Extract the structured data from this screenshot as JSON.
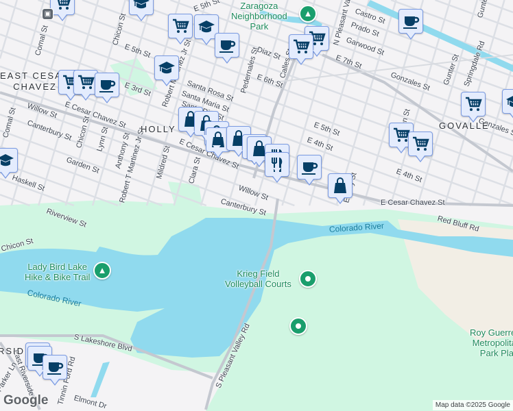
{
  "map": {
    "colors": {
      "land": "#f4f3f5",
      "water": "#90daee",
      "park": "#d0f6e2",
      "sand": "#f2eee5",
      "road": "#d6d9e0",
      "major_road": "#c4c8d0",
      "marker_bg": "#e4ecfd",
      "marker_border": "#7b9be2",
      "marker_icon": "#063f66",
      "park_pin": "#1a9e6c"
    },
    "neighborhoods": [
      "EAST CESAR\nCHAVEZ",
      "HOLLY",
      "GOVALLE",
      "RSIDE"
    ],
    "parks": [
      "Parque\nZaragoza\nNeighborhood\nPark",
      "Lady Bird Lake\nHike & Bike Trail",
      "Krieg Field\nVolleyball Courts",
      "Roy Guerrero\nMetropolitan\nPark Pla"
    ],
    "water": [
      "Colorado River",
      "Colorado River"
    ],
    "streets": [
      "E 5th St",
      "Comal St",
      "Chicon St",
      "E 5th St",
      "Robert Martinez Jr St",
      "Santa Rosa St",
      "Santa Maria St",
      "Santa Rita St",
      "E 3rd St",
      "Willow St",
      "E Cesar Chavez St",
      "Canterbury St",
      "Comal St",
      "Chicon St",
      "Lynn St",
      "Anthony St",
      "Robert T Martinez Jr St",
      "Mildred St",
      "Clara St",
      "Garden St",
      "Haskell St",
      "E Cesar Chavez St",
      "Willow St",
      "Canterbury St",
      "Riverview St",
      "Chicon St",
      "Pedernales St",
      "Diaz St",
      "E 6th St",
      "Calles St",
      "N Pleasant Valley Rd",
      "Castro St",
      "Prado St",
      "Garwood St",
      "E 7th St",
      "Gonzales St",
      "Gunter St",
      "Allen St",
      "E 5th St",
      "E 4th St",
      "E 4th St",
      "Gonzales St",
      "Springdale Rd",
      "E Cesar Chavez St",
      "Red Bluff Rd",
      "Emery St",
      "S Lakeshore Blvd",
      "S Pleasant Valley Rd",
      "Tinnin Ford Rd",
      "Elmont Dr",
      "East Riverside Dr",
      "Parker Ln",
      "Gunter St"
    ],
    "markers": [
      "grocery",
      "school",
      "grocery",
      "school",
      "cafe",
      "school",
      "grocery",
      "grocery",
      "cafe",
      "shopping",
      "shopping",
      "shopping",
      "shopping",
      "shopping",
      "shopping",
      "shopping",
      "restaurant",
      "restaurant",
      "cafe",
      "shopping",
      "grocery",
      "grocery",
      "cafe",
      "grocery",
      "school",
      "grocery",
      "grocery",
      "school",
      "cafe",
      "cafe",
      "cafe"
    ],
    "park_pins": [
      "tree",
      "tree",
      "place",
      "place"
    ],
    "transit_icon": "bus-icon",
    "logo": "Google",
    "attribution": "Map data ©2025 Google"
  }
}
